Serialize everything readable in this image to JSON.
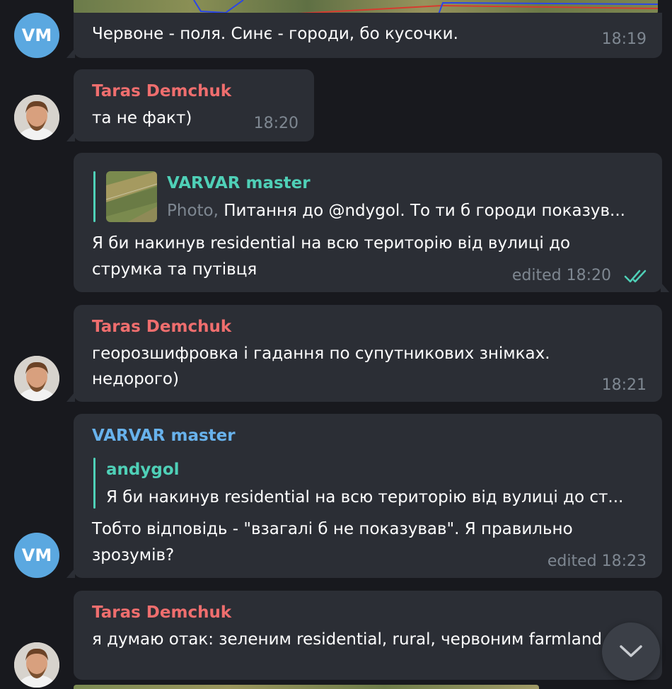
{
  "colors": {
    "background": "#18191e",
    "bubble": "#2b2e35",
    "sender_taras": "#ef6e6e",
    "sender_varvar": "#68b2ec",
    "quote_accent": "#4fd0b7",
    "time": "#7e8791",
    "read_check": "#4fd0b7",
    "avatar_vm": "#5ba8e0"
  },
  "messages": [
    {
      "avatar": "VM",
      "text": "Червоне - поля. Синє - городи, бо кусочки.",
      "time": "18:19"
    },
    {
      "sender": "Taras Demchuk",
      "avatar_icon": "user-photo-avatar",
      "text": "та не факт)",
      "time": "18:20"
    },
    {
      "reply": {
        "author": "VARVAR master",
        "prefix": "Photo,",
        "preview": "Питання до @ndygol. То ти б городи показув..."
      },
      "text_lines": [
        "Я би накинув residential на всю територію від вулиці до",
        "струмка та путівця"
      ],
      "time": "edited 18:20",
      "status_icon": "double-check-icon"
    },
    {
      "sender": "Taras Demchuk",
      "avatar_icon": "user-photo-avatar",
      "text_lines": [
        "георозшифровка і гадання по супутникових знімках.",
        "недорого)"
      ],
      "time": "18:21"
    },
    {
      "sender": "VARVAR master",
      "avatar": "VM",
      "reply": {
        "author": "andygol",
        "preview": "Я би накинув residential на всю територію від вулиці до ст..."
      },
      "text_lines": [
        "Тобто відповідь - \"взагалі б не показував\". Я правильно",
        "зрозумів?"
      ],
      "time": "edited 18:23"
    },
    {
      "sender": "Taras Demchuk",
      "avatar_icon": "user-photo-avatar",
      "text": "я думаю отак: зеленим residential, rural, червоним farmland"
    }
  ],
  "scroll_button_icon": "chevron-down-icon"
}
